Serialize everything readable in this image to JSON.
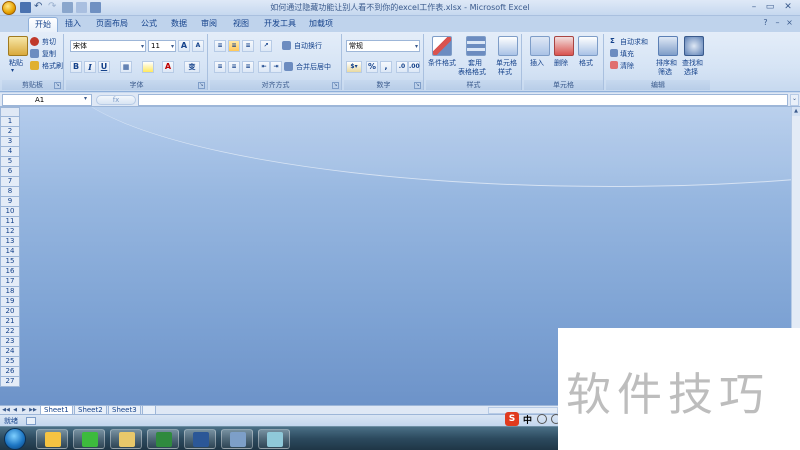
{
  "window": {
    "title": "如何通过隐藏功能让别人看不到你的excel工作表.xlsx - Microsoft Excel",
    "min_label": "–",
    "max_label": "▭",
    "close_label": "✕"
  },
  "ribbon_tabs": [
    "开始",
    "插入",
    "页面布局",
    "公式",
    "数据",
    "审阅",
    "视图",
    "开发工具",
    "加载项"
  ],
  "active_tab": "开始",
  "clipboard": {
    "paste_label": "粘贴",
    "cut_label": "剪切",
    "copy_label": "复制",
    "format_painter_label": "格式刷",
    "group_label": "剪贴板"
  },
  "font": {
    "font_name": "宋体",
    "font_size": "11",
    "bold": "B",
    "italic": "I",
    "underline": "U",
    "grow": "A",
    "shrink": "A",
    "phonetic": "变",
    "group_label": "字体"
  },
  "alignment": {
    "wrap_text_label": "自动换行",
    "merge_center_label": "合并后居中",
    "group_label": "对齐方式"
  },
  "number": {
    "format_value": "常规",
    "percent": "%",
    "comma": ",",
    "group_label": "数字"
  },
  "styles": {
    "conditional_label": "条件格式",
    "table_label_1": "套用",
    "table_label_2": "表格格式",
    "cell_styles_label_1": "单元格",
    "cell_styles_label_2": "样式",
    "group_label": "样式"
  },
  "cells": {
    "insert_label": "插入",
    "delete_label": "删除",
    "format_label": "格式",
    "group_label": "单元格"
  },
  "editing": {
    "autosum_label": "自动求和",
    "fill_label": "填充",
    "clear_label": "清除",
    "sort_label_1": "排序和",
    "sort_label_2": "筛选",
    "find_label_1": "查找和",
    "find_label_2": "选择",
    "group_label": "编辑"
  },
  "formula_bar": {
    "name_box": "A1",
    "fx_label": "fx",
    "formula_value": ""
  },
  "row_numbers": [
    "1",
    "2",
    "3",
    "4",
    "5",
    "6",
    "7",
    "8",
    "9",
    "10",
    "11",
    "12",
    "13",
    "14",
    "15",
    "16",
    "17",
    "18",
    "19",
    "20",
    "21",
    "22",
    "23",
    "24",
    "25",
    "26",
    "27"
  ],
  "sheets": [
    "Sheet1",
    "Sheet2",
    "Sheet3"
  ],
  "active_sheet": "Sheet1",
  "status": {
    "ready_label": "就绪"
  },
  "ime": {
    "logo": "S",
    "lang": "中"
  },
  "watermark": {
    "text": "软件技巧"
  },
  "colors": {
    "ribbon_text": "#15428b",
    "workspace_top": "#b4ccec",
    "workspace_bottom": "#6d93c9",
    "taskbar": "#2c4a5e"
  },
  "taskbar_icons": [
    "qq-icon",
    "wechat-icon",
    "file-explorer-icon",
    "excel-icon",
    "word-icon",
    "paint-icon",
    "notes-icon"
  ]
}
